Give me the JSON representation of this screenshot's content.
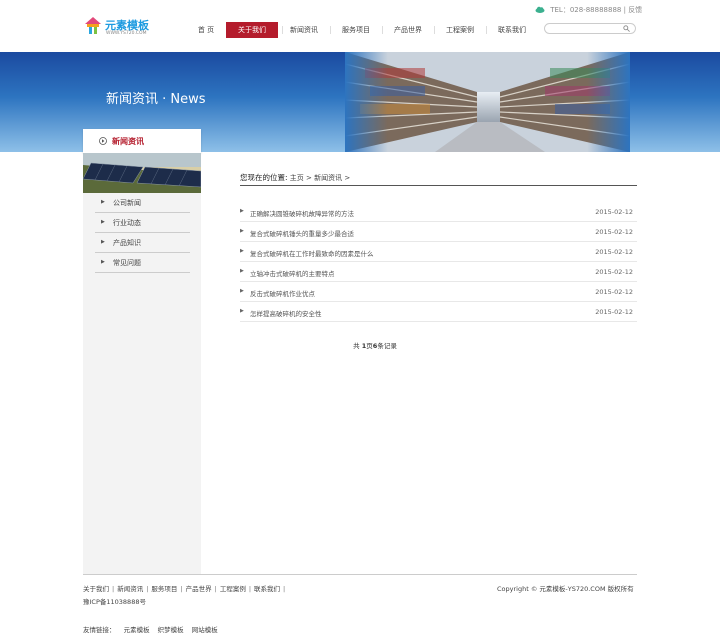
{
  "logo": {
    "title": "元素模板",
    "subtitle": "WWW.YS720.COM"
  },
  "contact": {
    "tel": "TEL：028-88888888",
    "separator": "|",
    "feedback": "反馈"
  },
  "search": {
    "placeholder": ""
  },
  "nav": [
    {
      "label": "首 页"
    },
    {
      "label": "关于我们",
      "active": true
    },
    {
      "label": "新闻资讯"
    },
    {
      "label": "服务项目"
    },
    {
      "label": "产品世界"
    },
    {
      "label": "工程案例"
    },
    {
      "label": "联系我们"
    }
  ],
  "banner": {
    "title": "新闻资讯 · News"
  },
  "sidebar": {
    "heading": "新闻资讯",
    "items": [
      {
        "label": "公司新闻"
      },
      {
        "label": "行业动态"
      },
      {
        "label": "产品知识"
      },
      {
        "label": "常见问题"
      }
    ]
  },
  "breadcrumb": {
    "label": "您现在的位置:",
    "home": "主页",
    "sep": ">",
    "current": "新闻资讯",
    "tail": ">"
  },
  "news": [
    {
      "title": "正确解决圆锥破碎机故障异常的方法",
      "date": "2015-02-12"
    },
    {
      "title": "复合式破碎机锤头的重量多少最合适",
      "date": "2015-02-12"
    },
    {
      "title": "复合式破碎机在工作时最致命的因素是什么",
      "date": "2015-02-12"
    },
    {
      "title": "立轴冲击式破碎机的主要特点",
      "date": "2015-02-12"
    },
    {
      "title": "反击式破碎机作业优点",
      "date": "2015-02-12"
    },
    {
      "title": "怎样提高破碎机的安全性",
      "date": "2015-02-12"
    }
  ],
  "pager": {
    "prefix": "共 ",
    "pages": "1",
    "mid": "页",
    "records": "6",
    "suffix": "条记录"
  },
  "footer": {
    "links": [
      "关于我们",
      "新闻资讯",
      "服务项目",
      "产品世界",
      "工程案例",
      "联系我们"
    ],
    "sep": "|",
    "icp": "豫ICP备11038888号",
    "copyright": "Copyright © 元素模板-YS720.COM 版权所有",
    "friend_label": "友情链接：",
    "friend_links": [
      "元素模板",
      "织梦模板",
      "网站模板"
    ]
  },
  "colors": {
    "accent": "#b41c2c",
    "banner_top": "#1b4aa0",
    "banner_bottom": "#8ec0e8",
    "logo": "#1d9be0"
  }
}
